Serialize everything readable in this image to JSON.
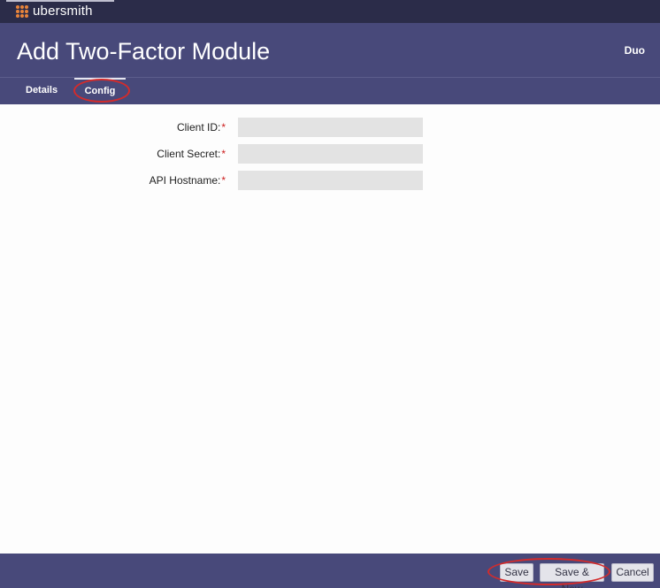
{
  "brand": {
    "name": "ubersmith"
  },
  "header": {
    "title": "Add Two-Factor Module",
    "module": "Duo"
  },
  "tabs": [
    {
      "label": "Details",
      "active": false
    },
    {
      "label": "Config",
      "active": true
    }
  ],
  "form": {
    "fields": [
      {
        "label": "Client ID:",
        "required_mark": "*",
        "value": ""
      },
      {
        "label": "Client Secret:",
        "required_mark": "*",
        "value": ""
      },
      {
        "label": "API Hostname:",
        "required_mark": "*",
        "value": ""
      }
    ]
  },
  "footer": {
    "save_label": "Save",
    "save_new_label": "Save & New",
    "cancel_label": "Cancel"
  },
  "colors": {
    "header_bg": "#48497a",
    "brandbar_bg": "#2b2c49",
    "logo_accent": "#e8843a",
    "annotation_red": "#d42b2b",
    "required_red": "#cc1f1f"
  }
}
